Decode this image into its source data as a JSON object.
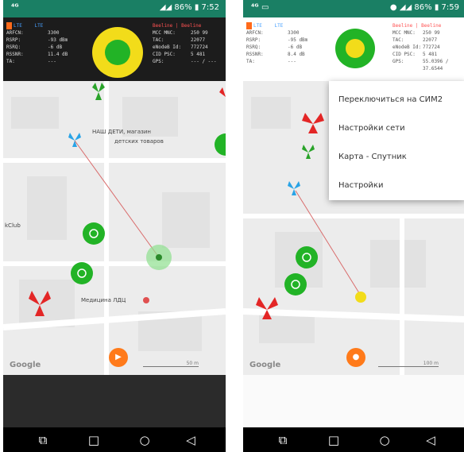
{
  "left": {
    "status": {
      "time": "7:52",
      "battery": "86%"
    },
    "info": {
      "sim": "1",
      "tech": [
        "LTE",
        "LTE"
      ],
      "labels": [
        "ARFCN:",
        "RSRP:",
        "RSRQ:",
        "RSSNR:",
        "TA:"
      ],
      "values": [
        "3300",
        "-93 dBm",
        "-6 dB",
        "11.4 dB",
        "---"
      ],
      "operator": "Beeline | Beeline",
      "right_labels": [
        "MCC MNC:",
        "TAC:",
        "eNodeB Id:",
        "CID PSC:",
        "GPS:"
      ],
      "right_values": [
        "250 99",
        "22077",
        "772724",
        "5 481",
        "--- / ---"
      ]
    },
    "map": {
      "poi_1": "НАШ ДЕТИ, магазин",
      "poi_2": "детских товаров",
      "poi_3": "Медицина ЛДЦ",
      "poi_4": "kClub",
      "google": "Google",
      "scale": "50 m"
    }
  },
  "right": {
    "status": {
      "time": "7:59",
      "battery": "86%"
    },
    "info": {
      "sim": "1",
      "tech": [
        "LTE",
        "LTE"
      ],
      "labels": [
        "ARFCN:",
        "RSRP:",
        "RSRQ:",
        "RSSNR:",
        "TA:"
      ],
      "values": [
        "3300",
        "-95 dBm",
        "-6 dB",
        "8.4 dB",
        "---"
      ],
      "operator": "Beeline | Beeline",
      "right_labels": [
        "MCC MNC:",
        "TAC:",
        "eNodeB Id:",
        "CID PSC:",
        "GPS:"
      ],
      "right_values": [
        "250 99",
        "22077",
        "772724",
        "5 481",
        "55.0396 / 37.6544"
      ]
    },
    "menu": {
      "items": [
        "Переключиться на СИМ2",
        "Настройки сети",
        "Карта - Спутник",
        "Настройки"
      ]
    },
    "map": {
      "google": "Google",
      "scale": "100 m"
    }
  },
  "navbar": {
    "keys": [
      "⧉",
      "□",
      "○",
      "◁"
    ]
  },
  "colors": {
    "status_bar": "#1a7f64",
    "info_bg": "#1c1c1c",
    "gauge_good": "#22b326",
    "gauge_warn": "#f2dc1a",
    "sector_red": "#e32626",
    "sector_green": "#29a329",
    "sector_blue": "#29a3e6",
    "fab": "#ff7a1a"
  }
}
